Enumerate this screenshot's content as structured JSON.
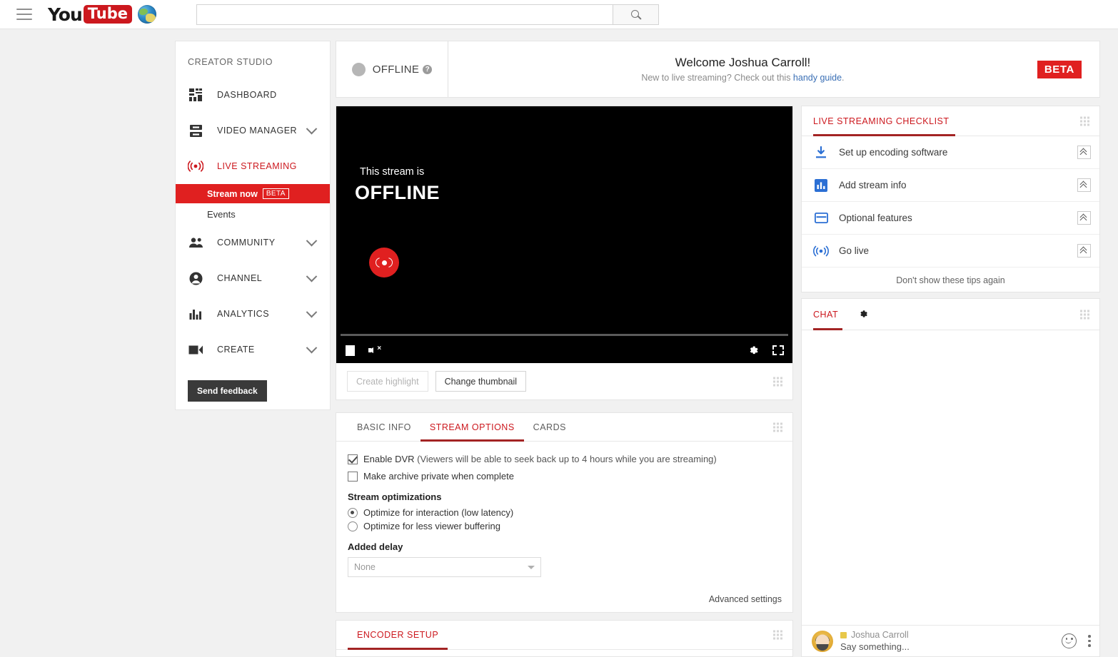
{
  "topbar": {
    "menu_icon": "hamburger-menu-icon",
    "logo_you": "You",
    "logo_tube": "Tube",
    "globe_icon": "globe-icon",
    "search_value": "",
    "search_placeholder": "",
    "search_icon": "search-icon"
  },
  "sidebar": {
    "title": "CREATOR STUDIO",
    "items": [
      {
        "label": "DASHBOARD",
        "icon": "dashboard-icon",
        "expandable": false,
        "active": false
      },
      {
        "label": "VIDEO MANAGER",
        "icon": "video-manager-icon",
        "expandable": true,
        "active": false
      },
      {
        "label": "LIVE STREAMING",
        "icon": "live-streaming-icon",
        "expandable": false,
        "active": true
      },
      {
        "label": "COMMUNITY",
        "icon": "community-people-icon",
        "expandable": true,
        "active": false
      },
      {
        "label": "CHANNEL",
        "icon": "channel-person-icon",
        "expandable": true,
        "active": false
      },
      {
        "label": "ANALYTICS",
        "icon": "analytics-bars-icon",
        "expandable": true,
        "active": false
      },
      {
        "label": "CREATE",
        "icon": "create-camera-icon",
        "expandable": true,
        "active": false
      }
    ],
    "sub_items": [
      {
        "label": "Stream now",
        "badge": "BETA",
        "active": true
      },
      {
        "label": "Events",
        "badge": "",
        "active": false
      }
    ],
    "feedback_label": "Send feedback"
  },
  "header": {
    "status_text": "OFFLINE",
    "status_help_icon": "question-mark-icon",
    "welcome_title": "Welcome Joshua Carroll!",
    "welcome_sub_prefix": "New to live streaming? Check out this ",
    "welcome_sub_link": "handy guide",
    "welcome_sub_suffix": ".",
    "beta_badge": "BETA"
  },
  "player": {
    "overlay_line1": "This stream is",
    "overlay_line2": "OFFLINE",
    "go_live_icon": "go-live-record-icon",
    "controls": {
      "stop_icon": "stop-icon",
      "mute_icon": "volume-muted-icon",
      "settings_icon": "gear-icon",
      "fullscreen_icon": "fullscreen-icon"
    },
    "actions": {
      "create_highlight": "Create highlight",
      "change_thumbnail": "Change thumbnail"
    }
  },
  "stream_options": {
    "tabs": [
      {
        "label": "BASIC INFO",
        "active": false
      },
      {
        "label": "STREAM OPTIONS",
        "active": true
      },
      {
        "label": "CARDS",
        "active": false
      }
    ],
    "enable_dvr_label": "Enable DVR",
    "enable_dvr_note": " (Viewers will be able to seek back up to 4 hours while you are streaming)",
    "enable_dvr_checked": true,
    "archive_private_label": "Make archive private when complete",
    "archive_private_checked": false,
    "optimizations_heading": "Stream optimizations",
    "radios": [
      {
        "label": "Optimize for interaction (low latency)",
        "selected": true
      },
      {
        "label": "Optimize for less viewer buffering",
        "selected": false
      }
    ],
    "added_delay_heading": "Added delay",
    "added_delay_value": "None",
    "advanced_settings_label": "Advanced settings"
  },
  "encoder": {
    "tab_label": "ENCODER SETUP"
  },
  "checklist": {
    "title": "LIVE STREAMING CHECKLIST",
    "items": [
      {
        "label": "Set up encoding software",
        "icon": "download-icon"
      },
      {
        "label": "Add stream info",
        "icon": "bar-chart-icon"
      },
      {
        "label": "Optional features",
        "icon": "card-panel-icon"
      },
      {
        "label": "Go live",
        "icon": "broadcast-icon"
      }
    ],
    "collapse_icon": "double-chevron-up-icon",
    "dismiss_label": "Don't show these tips again"
  },
  "chat": {
    "tab_label": "CHAT",
    "settings_icon": "gear-icon",
    "author_name": "Joshua Carroll",
    "author_badge_icon": "moderator-badge-icon",
    "input_placeholder": "Say something...",
    "emoji_icon": "emoji-smiley-icon",
    "more_icon": "kebab-menu-icon"
  },
  "colors": {
    "brand_red": "#cc181e",
    "active_red": "#e02020",
    "underline_red": "#a32424",
    "page_bg": "#f1f1f1",
    "card_bg": "#ffffff"
  }
}
